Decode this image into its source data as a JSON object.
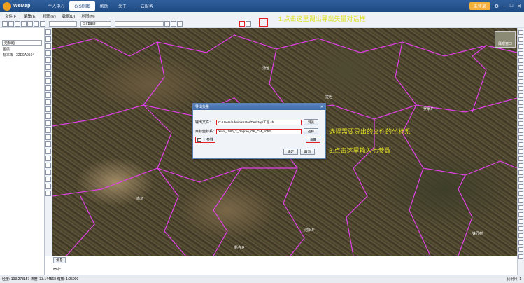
{
  "app": {
    "title": "WeMap"
  },
  "menu": [
    {
      "label": "个人中心"
    },
    {
      "label": "GIS制图"
    },
    {
      "label": "帮助"
    },
    {
      "label": "关于"
    },
    {
      "label": "一云服务"
    }
  ],
  "title_right": {
    "login": "未登录"
  },
  "toolbar_menu": [
    {
      "label": "文件(F)"
    },
    {
      "label": "编辑(E)"
    },
    {
      "label": "视图(V)"
    },
    {
      "label": "数据(D)"
    },
    {
      "label": "地图(M)"
    }
  ],
  "toolbar_selects": {
    "layer": "",
    "font": "SVbase"
  },
  "sidebar": {
    "field": "无标题",
    "tree": [
      {
        "label": "图层",
        "value": ""
      },
      {
        "label": "标本库",
        "value": "32E0A0504"
      }
    ]
  },
  "annotations": {
    "step1": "1.点击这里调出导出矢量对话框",
    "step2": "选择需要导出的文件的坐标系",
    "step3": "3.点击这里输入七参数"
  },
  "map": {
    "overview_label": "鹰眼窗口",
    "places": [
      "汤池",
      "拉巴",
      "曲县",
      "罗家乡",
      "白马",
      "河阳乡",
      "铁匠村",
      "新寺乡"
    ]
  },
  "dialog": {
    "title": "导出矢量",
    "output_label": "输出文件：",
    "output_value": "C:/Users/Administrator/Desktop/工程.shl",
    "browse_label": "浏览",
    "crs_label": "目标坐标系：",
    "crs_value": "Xian_1980_3_Degree_GK_CM_105E",
    "select_label": "选择",
    "seven_param_label": "七参数",
    "settings_label": "设置",
    "ok_label": "确定",
    "cancel_label": "取消"
  },
  "bottom_panel": {
    "tab": "消息",
    "cmd": "命令:"
  },
  "status": {
    "coords": "经度: 103.273157 纬度: 33.144568 缩放: 1:25000",
    "scale": "比例尺: 1"
  }
}
